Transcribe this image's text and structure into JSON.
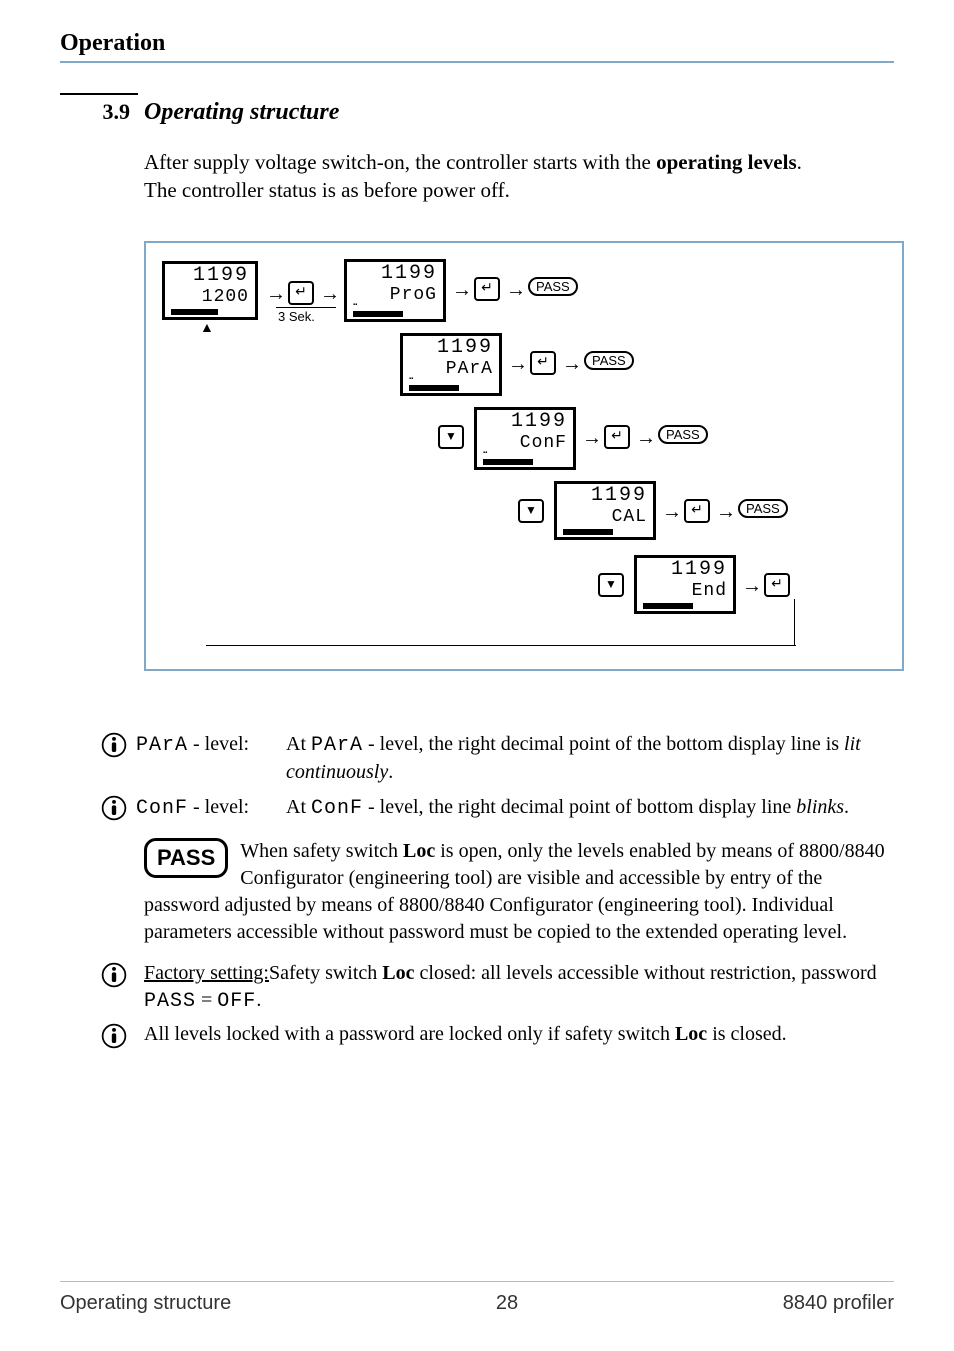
{
  "header": {
    "section": "Operation"
  },
  "section": {
    "number": "3.9",
    "title": "Operating structure"
  },
  "intro": {
    "line1_a": "After supply voltage switch-on, the controller starts with the ",
    "line1_b": "operating levels",
    "line1_c": ".",
    "line2": "The controller status is as before power off."
  },
  "diagram": {
    "sek_label": "3 Sek.",
    "pass_label": "PASS",
    "lcd_main": {
      "l1": "1199",
      "l2": "1200"
    },
    "lcd_prog": {
      "l1": "1199",
      "l2": "ProG"
    },
    "lcd_para": {
      "l1": "1199",
      "l2": "PArA"
    },
    "lcd_conf": {
      "l1": "1199",
      "l2": "ConF"
    },
    "lcd_cal": {
      "l1": "1199",
      "l2": "CAL"
    },
    "lcd_end": {
      "l1": "1199",
      "l2": "End"
    }
  },
  "notes": {
    "para_code": "PArA",
    "para_level_suffix": " - level:",
    "para_body_a": "At ",
    "para_body_b": " - level, the right decimal point of the bottom display line is ",
    "para_body_c": "lit continuously",
    "para_body_d": ".",
    "conf_code": "ConF",
    "conf_level_suffix": " - level:",
    "conf_body_a": "At ",
    "conf_body_b": " - level, the right decimal point of bottom display line ",
    "conf_body_c": "blinks",
    "conf_body_d": "."
  },
  "pass": {
    "badge": "PASS",
    "text_a": "When safety switch ",
    "loc": "Loc",
    "text_b": " is open, only the levels enabled by means of  8800/8840 Configurator (engineering tool) are visible and accessible by entry of the password adjusted by means of 8800/8840 Configurator (engineering tool). Individual parameters accessible without password must be copied to the extended operating level."
  },
  "factory": {
    "lead_u": "Factory setting:",
    "text_a": "Safety switch ",
    "loc": "Loc",
    "text_b": " closed: all levels accessible without restriction, password ",
    "pass_code": "PASS",
    "eq": " = ",
    "off_code": "OFF",
    "period": "."
  },
  "locked": {
    "text_a": "All levels locked with a password are locked only if safety switch ",
    "loc": "Loc",
    "text_b": " is closed."
  },
  "footer": {
    "left": "Operating structure",
    "center": "28",
    "right": "8840 profiler"
  }
}
